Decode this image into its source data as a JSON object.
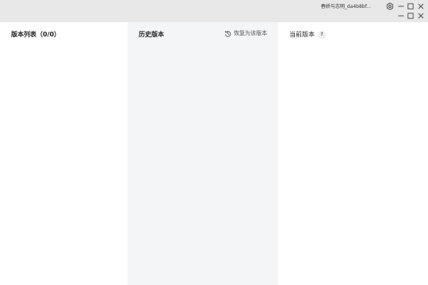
{
  "window": {
    "doc_title": "春娇与志明_da4b8bf..."
  },
  "panes": {
    "list": {
      "title": "版本列表（0/0）"
    },
    "history": {
      "title": "历史版本",
      "restore_label": "恢复为该版本"
    },
    "current": {
      "title": "当前版本",
      "help_label": "?"
    }
  },
  "colors": {
    "titlebar": "#e8e8e8",
    "history_bg": "#f4f5f7",
    "text": "#1f1f1f"
  }
}
